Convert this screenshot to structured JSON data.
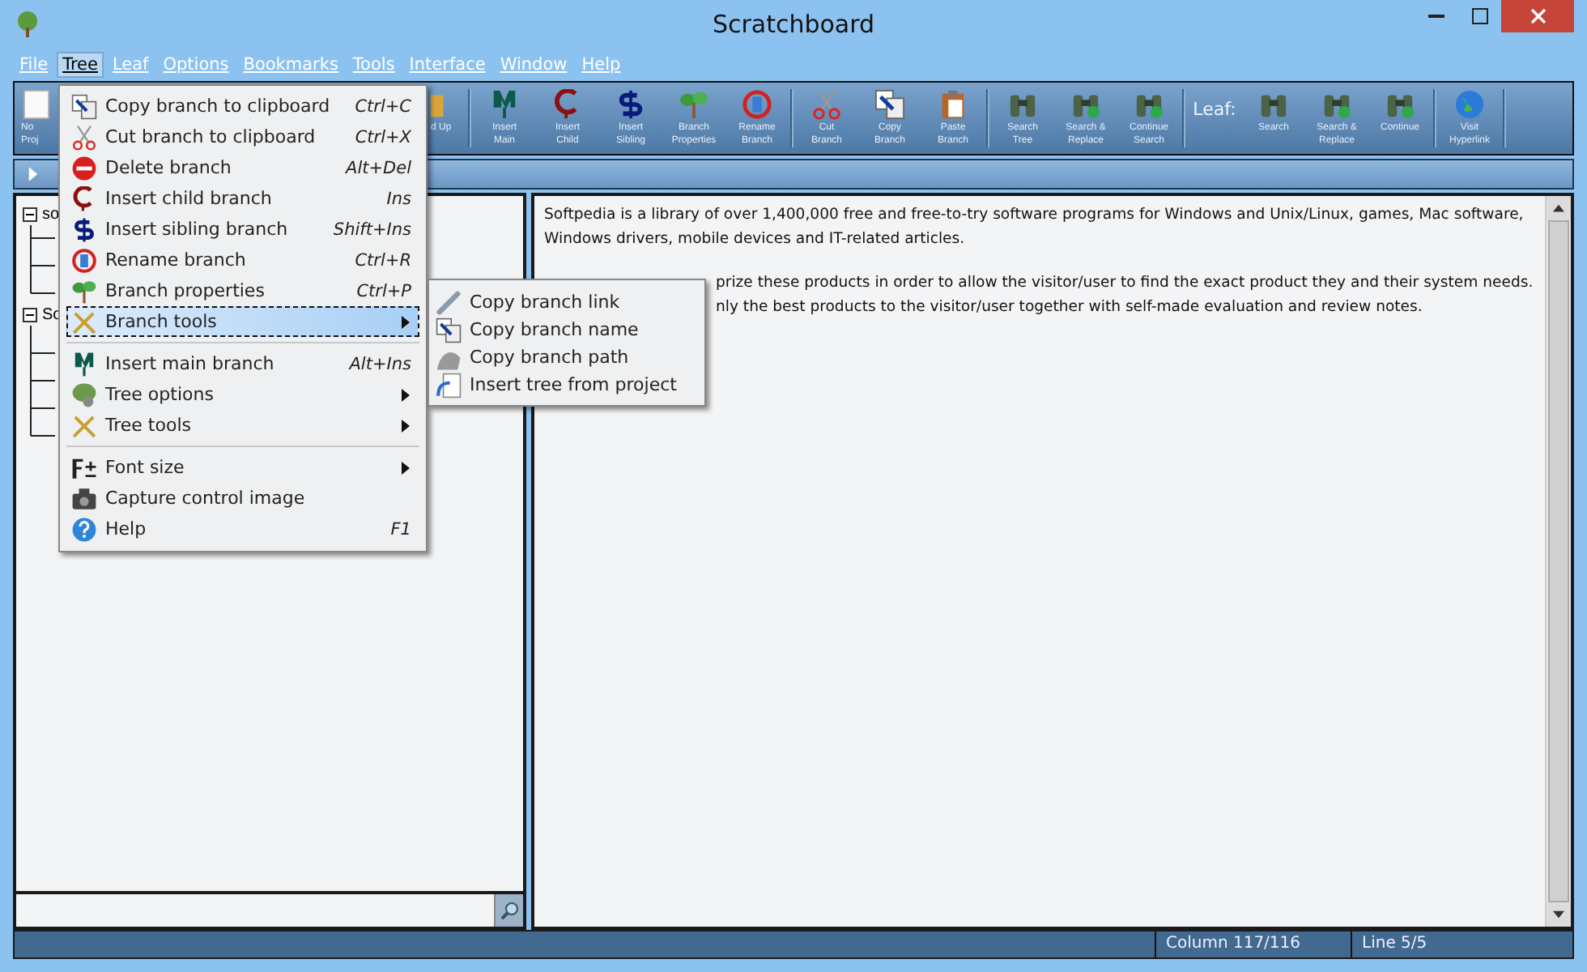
{
  "window": {
    "title": "Scratchboard"
  },
  "menu_bar": [
    {
      "label": "File",
      "selected": false
    },
    {
      "label": "Tree",
      "selected": true
    },
    {
      "label": "Leaf",
      "selected": false
    },
    {
      "label": "Options",
      "selected": false
    },
    {
      "label": "Bookmarks",
      "selected": false
    },
    {
      "label": "Tools",
      "selected": false
    },
    {
      "label": "Interface",
      "selected": false
    },
    {
      "label": "Window",
      "selected": false
    },
    {
      "label": "Help",
      "selected": false
    }
  ],
  "toolbar": [
    {
      "kind": "cut",
      "lines": [
        "No",
        "Proj"
      ]
    },
    {
      "kind": "cut",
      "lines": [
        "d Up"
      ]
    },
    {
      "kind": "separator"
    },
    {
      "kind": "button",
      "lines": [
        "Insert",
        "Main"
      ]
    },
    {
      "kind": "button",
      "lines": [
        "Insert",
        "Child"
      ]
    },
    {
      "kind": "button",
      "lines": [
        "Insert",
        "Sibling"
      ]
    },
    {
      "kind": "button",
      "lines": [
        "Branch",
        "Properties"
      ]
    },
    {
      "kind": "button",
      "lines": [
        "Rename",
        "Branch"
      ]
    },
    {
      "kind": "separator"
    },
    {
      "kind": "button",
      "lines": [
        "Cut",
        "Branch"
      ]
    },
    {
      "kind": "button",
      "lines": [
        "Copy",
        "Branch"
      ]
    },
    {
      "kind": "button",
      "lines": [
        "Paste",
        "Branch"
      ]
    },
    {
      "kind": "separator"
    },
    {
      "kind": "button",
      "lines": [
        "Search",
        "Tree"
      ]
    },
    {
      "kind": "button",
      "lines": [
        "Search &",
        "Replace"
      ]
    },
    {
      "kind": "button",
      "lines": [
        "Continue",
        "Search"
      ]
    },
    {
      "kind": "separator"
    },
    {
      "kind": "label",
      "lines": [
        "Leaf:"
      ]
    },
    {
      "kind": "button",
      "lines": [
        "Search"
      ]
    },
    {
      "kind": "button",
      "lines": [
        "Search &",
        "Replace"
      ]
    },
    {
      "kind": "button",
      "lines": [
        "Continue"
      ]
    },
    {
      "kind": "separator"
    },
    {
      "kind": "button",
      "lines": [
        "Visit",
        "Hyperlink"
      ]
    },
    {
      "kind": "separator"
    }
  ],
  "tree": [
    {
      "label": "so",
      "expanded": true
    },
    {
      "label": "So",
      "expanded": true
    }
  ],
  "editor": {
    "paragraphs": [
      [
        "Softpedia is a library of over 1,400,000 free and free-to-try software programs for Windows and Unix/Linux, games, Mac software,",
        "Windows drivers, mobile devices and IT-related articles."
      ],
      [
        "prize these products in order to allow the visitor/user to find the exact product they and their system needs.",
        "nly the best products to the visitor/user together with self-made evaluation and review notes."
      ]
    ]
  },
  "tree_menu": [
    {
      "kind": "item",
      "label": "Copy branch to clipboard",
      "shortcut": "Ctrl+C",
      "submenu": false,
      "selected": false
    },
    {
      "kind": "item",
      "label": "Cut branch to clipboard",
      "shortcut": "Ctrl+X",
      "submenu": false,
      "selected": false
    },
    {
      "kind": "item",
      "label": "Delete branch",
      "shortcut": "Alt+Del",
      "submenu": false,
      "selected": false
    },
    {
      "kind": "item",
      "label": "Insert child branch",
      "shortcut": "Ins",
      "submenu": false,
      "selected": false
    },
    {
      "kind": "item",
      "label": "Insert sibling branch",
      "shortcut": "Shift+Ins",
      "submenu": false,
      "selected": false
    },
    {
      "kind": "item",
      "label": "Rename branch",
      "shortcut": "Ctrl+R",
      "submenu": false,
      "selected": false
    },
    {
      "kind": "item",
      "label": "Branch properties",
      "shortcut": "Ctrl+P",
      "submenu": false,
      "selected": false
    },
    {
      "kind": "item",
      "label": "Branch tools",
      "submenu": true,
      "selected": true
    },
    {
      "kind": "separator"
    },
    {
      "kind": "item",
      "label": "Insert main branch",
      "shortcut": "Alt+Ins",
      "submenu": false,
      "selected": false
    },
    {
      "kind": "item",
      "label": "Tree options",
      "submenu": true,
      "selected": false
    },
    {
      "kind": "item",
      "label": "Tree tools",
      "submenu": true,
      "selected": false
    },
    {
      "kind": "separator"
    },
    {
      "kind": "item",
      "label": "Font size",
      "submenu": true,
      "selected": false
    },
    {
      "kind": "item",
      "label": "Capture control image",
      "submenu": false,
      "selected": false
    },
    {
      "kind": "item",
      "label": "Help",
      "shortcut": "F1",
      "submenu": false,
      "selected": false
    }
  ],
  "branch_tools_menu": [
    "Copy branch link",
    "Copy branch name",
    "Copy branch path",
    "Insert tree from project"
  ],
  "status_bar": [
    "Column 117/116",
    "Line 5/5"
  ]
}
